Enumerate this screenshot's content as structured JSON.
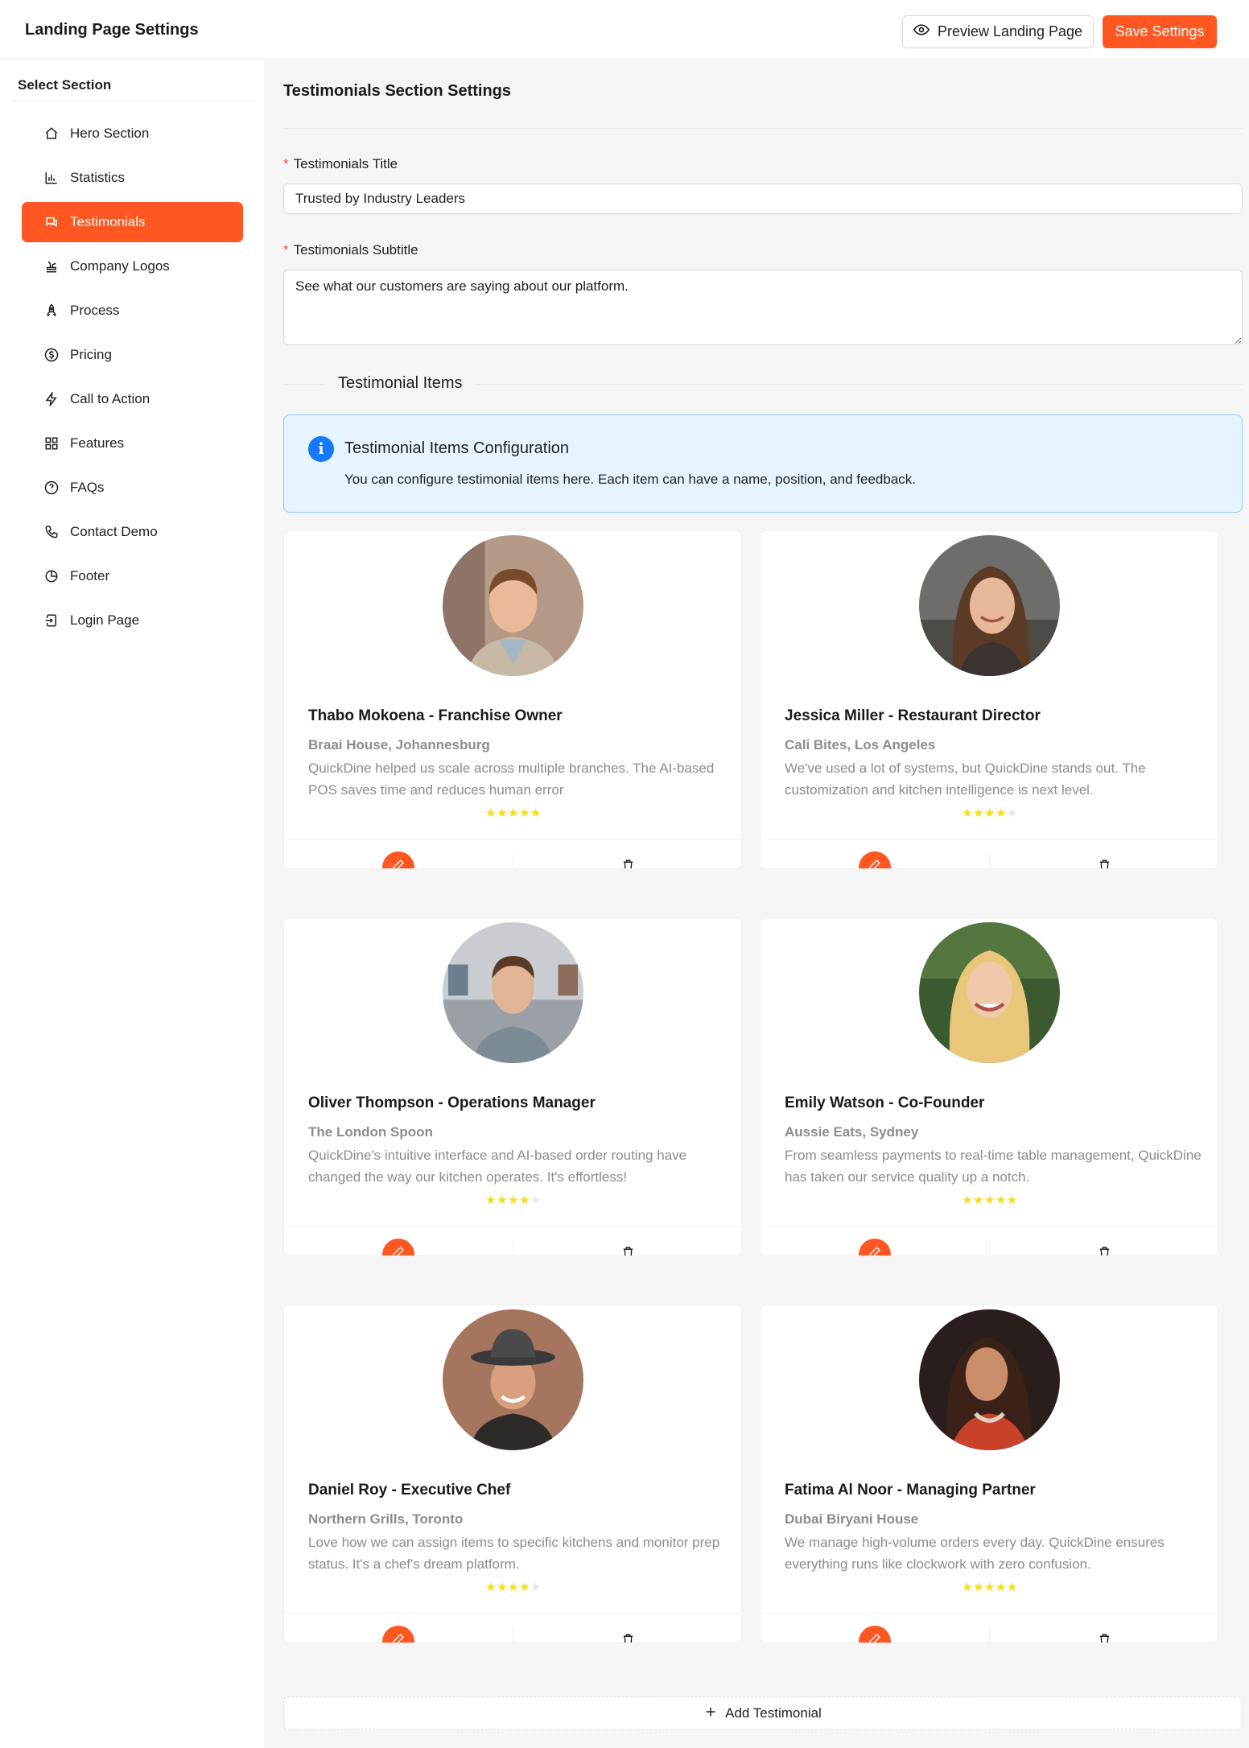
{
  "header": {
    "title": "Landing Page Settings",
    "preview_label": "Preview Landing Page",
    "save_label": "Save Settings"
  },
  "sidebar": {
    "heading": "Select Section",
    "items": [
      {
        "label": "Hero Section",
        "icon": "home-icon"
      },
      {
        "label": "Statistics",
        "icon": "bar-chart-icon"
      },
      {
        "label": "Testimonials",
        "icon": "chat-bubbles-icon",
        "active": true
      },
      {
        "label": "Company Logos",
        "icon": "stamp-icon"
      },
      {
        "label": "Process",
        "icon": "rocket-icon"
      },
      {
        "label": "Pricing",
        "icon": "dollar-circle-icon"
      },
      {
        "label": "Call to Action",
        "icon": "lightning-icon"
      },
      {
        "label": "Features",
        "icon": "grid-icon"
      },
      {
        "label": "FAQs",
        "icon": "question-circle-icon"
      },
      {
        "label": "Contact Demo",
        "icon": "phone-icon"
      },
      {
        "label": "Footer",
        "icon": "pie-chart-icon"
      },
      {
        "label": "Login Page",
        "icon": "login-icon"
      }
    ]
  },
  "main": {
    "section_title": "Testimonials Section Settings",
    "title_field": {
      "required_mark": "*",
      "label": "Testimonials Title",
      "value": "Trusted by Industry Leaders"
    },
    "subtitle_field": {
      "required_mark": "*",
      "label": "Testimonials Subtitle",
      "value": "See what our customers are saying about our platform."
    },
    "items_divider": "Testimonial Items",
    "info": {
      "title": "Testimonial Items Configuration",
      "description": "You can configure testimonial items here. Each item can have a name, position, and feedback."
    },
    "testimonials": [
      {
        "name": "Thabo Mokoena - Franchise Owner",
        "company": "Braai House, Johannesburg",
        "feedback": "QuickDine helped us scale across multiple branches. The AI-based POS saves time and reduces human error",
        "rating": 5
      },
      {
        "name": "Jessica Miller - Restaurant Director",
        "company": "Cali Bites, Los Angeles",
        "feedback": "We've used a lot of systems, but QuickDine stands out. The customization and kitchen intelligence is next level.",
        "rating": 4
      },
      {
        "name": "Oliver Thompson - Operations Manager",
        "company": "The London Spoon",
        "feedback": "QuickDine's intuitive interface and AI-based order routing have changed the way our kitchen operates. It's effortless!",
        "rating": 4
      },
      {
        "name": "Emily Watson - Co-Founder",
        "company": "Aussie Eats, Sydney",
        "feedback": "From seamless payments to real-time table management, QuickDine has taken our service quality up a notch.",
        "rating": 5
      },
      {
        "name": "Daniel Roy - Executive Chef",
        "company": "Northern Grills, Toronto",
        "feedback": "Love how we can assign items to specific kitchens and monitor prep status. It's a chef's dream platform.",
        "rating": 4
      },
      {
        "name": "Fatima Al Noor - Managing Partner",
        "company": "Dubai Biryani House",
        "feedback": "We manage high-volume orders every day. QuickDine ensures everything runs like clockwork with zero confusion.",
        "rating": 5
      }
    ],
    "add_label": "Add Testimonial"
  },
  "colors": {
    "accent": "#ff5722",
    "star": "#fadb14",
    "info_bg": "#e6f4ff",
    "info_border": "#91caff",
    "info_icon": "#1677ff"
  }
}
